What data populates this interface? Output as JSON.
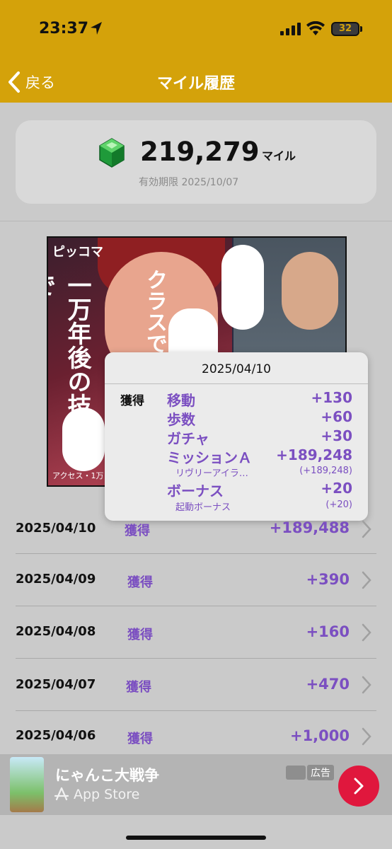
{
  "status_bar": {
    "time": "23:37",
    "battery": "32"
  },
  "nav": {
    "back_label": "戻る",
    "title": "マイル履歴"
  },
  "balance": {
    "value": "219,279",
    "unit": "マイル",
    "expiry": "有効期限 2025/10/07"
  },
  "ad_banner": {
    "brand": "ピッコマ",
    "headline": "一万年後の技術で…",
    "side_text": "クラスで",
    "footer": "アクセス・1万"
  },
  "popup": {
    "date": "2025/04/10",
    "kind": "獲得",
    "rows": [
      {
        "label": "移動",
        "amount": "+130",
        "type": "main"
      },
      {
        "label": "歩数",
        "amount": "+60",
        "type": "main"
      },
      {
        "label": "ガチャ",
        "amount": "+30",
        "type": "main"
      },
      {
        "label": "ミッションＡ",
        "amount": "+189,248",
        "type": "main"
      },
      {
        "label": "リヴリーアイラ…",
        "amount": "(+189,248)",
        "type": "sub"
      },
      {
        "label": "ボーナス",
        "amount": "+20",
        "type": "main"
      },
      {
        "label": "起動ボーナス",
        "amount": "(+20)",
        "type": "sub"
      }
    ]
  },
  "history": [
    {
      "date": "2025/04/10",
      "kind": "獲得",
      "amount": "+189,488"
    },
    {
      "date": "2025/04/09",
      "kind": "獲得",
      "amount": "+390"
    },
    {
      "date": "2025/04/08",
      "kind": "獲得",
      "amount": "+160"
    },
    {
      "date": "2025/04/07",
      "kind": "獲得",
      "amount": "+470"
    },
    {
      "date": "2025/04/06",
      "kind": "獲得",
      "amount": "+1,000"
    }
  ],
  "bottom_ad": {
    "title": "にゃんこ大戦争",
    "store": "App Store",
    "badge": "広告"
  },
  "colors": {
    "header": "#d4a20a",
    "accent_purple": "#7b4fc1",
    "ad_button": "#e0173d"
  }
}
